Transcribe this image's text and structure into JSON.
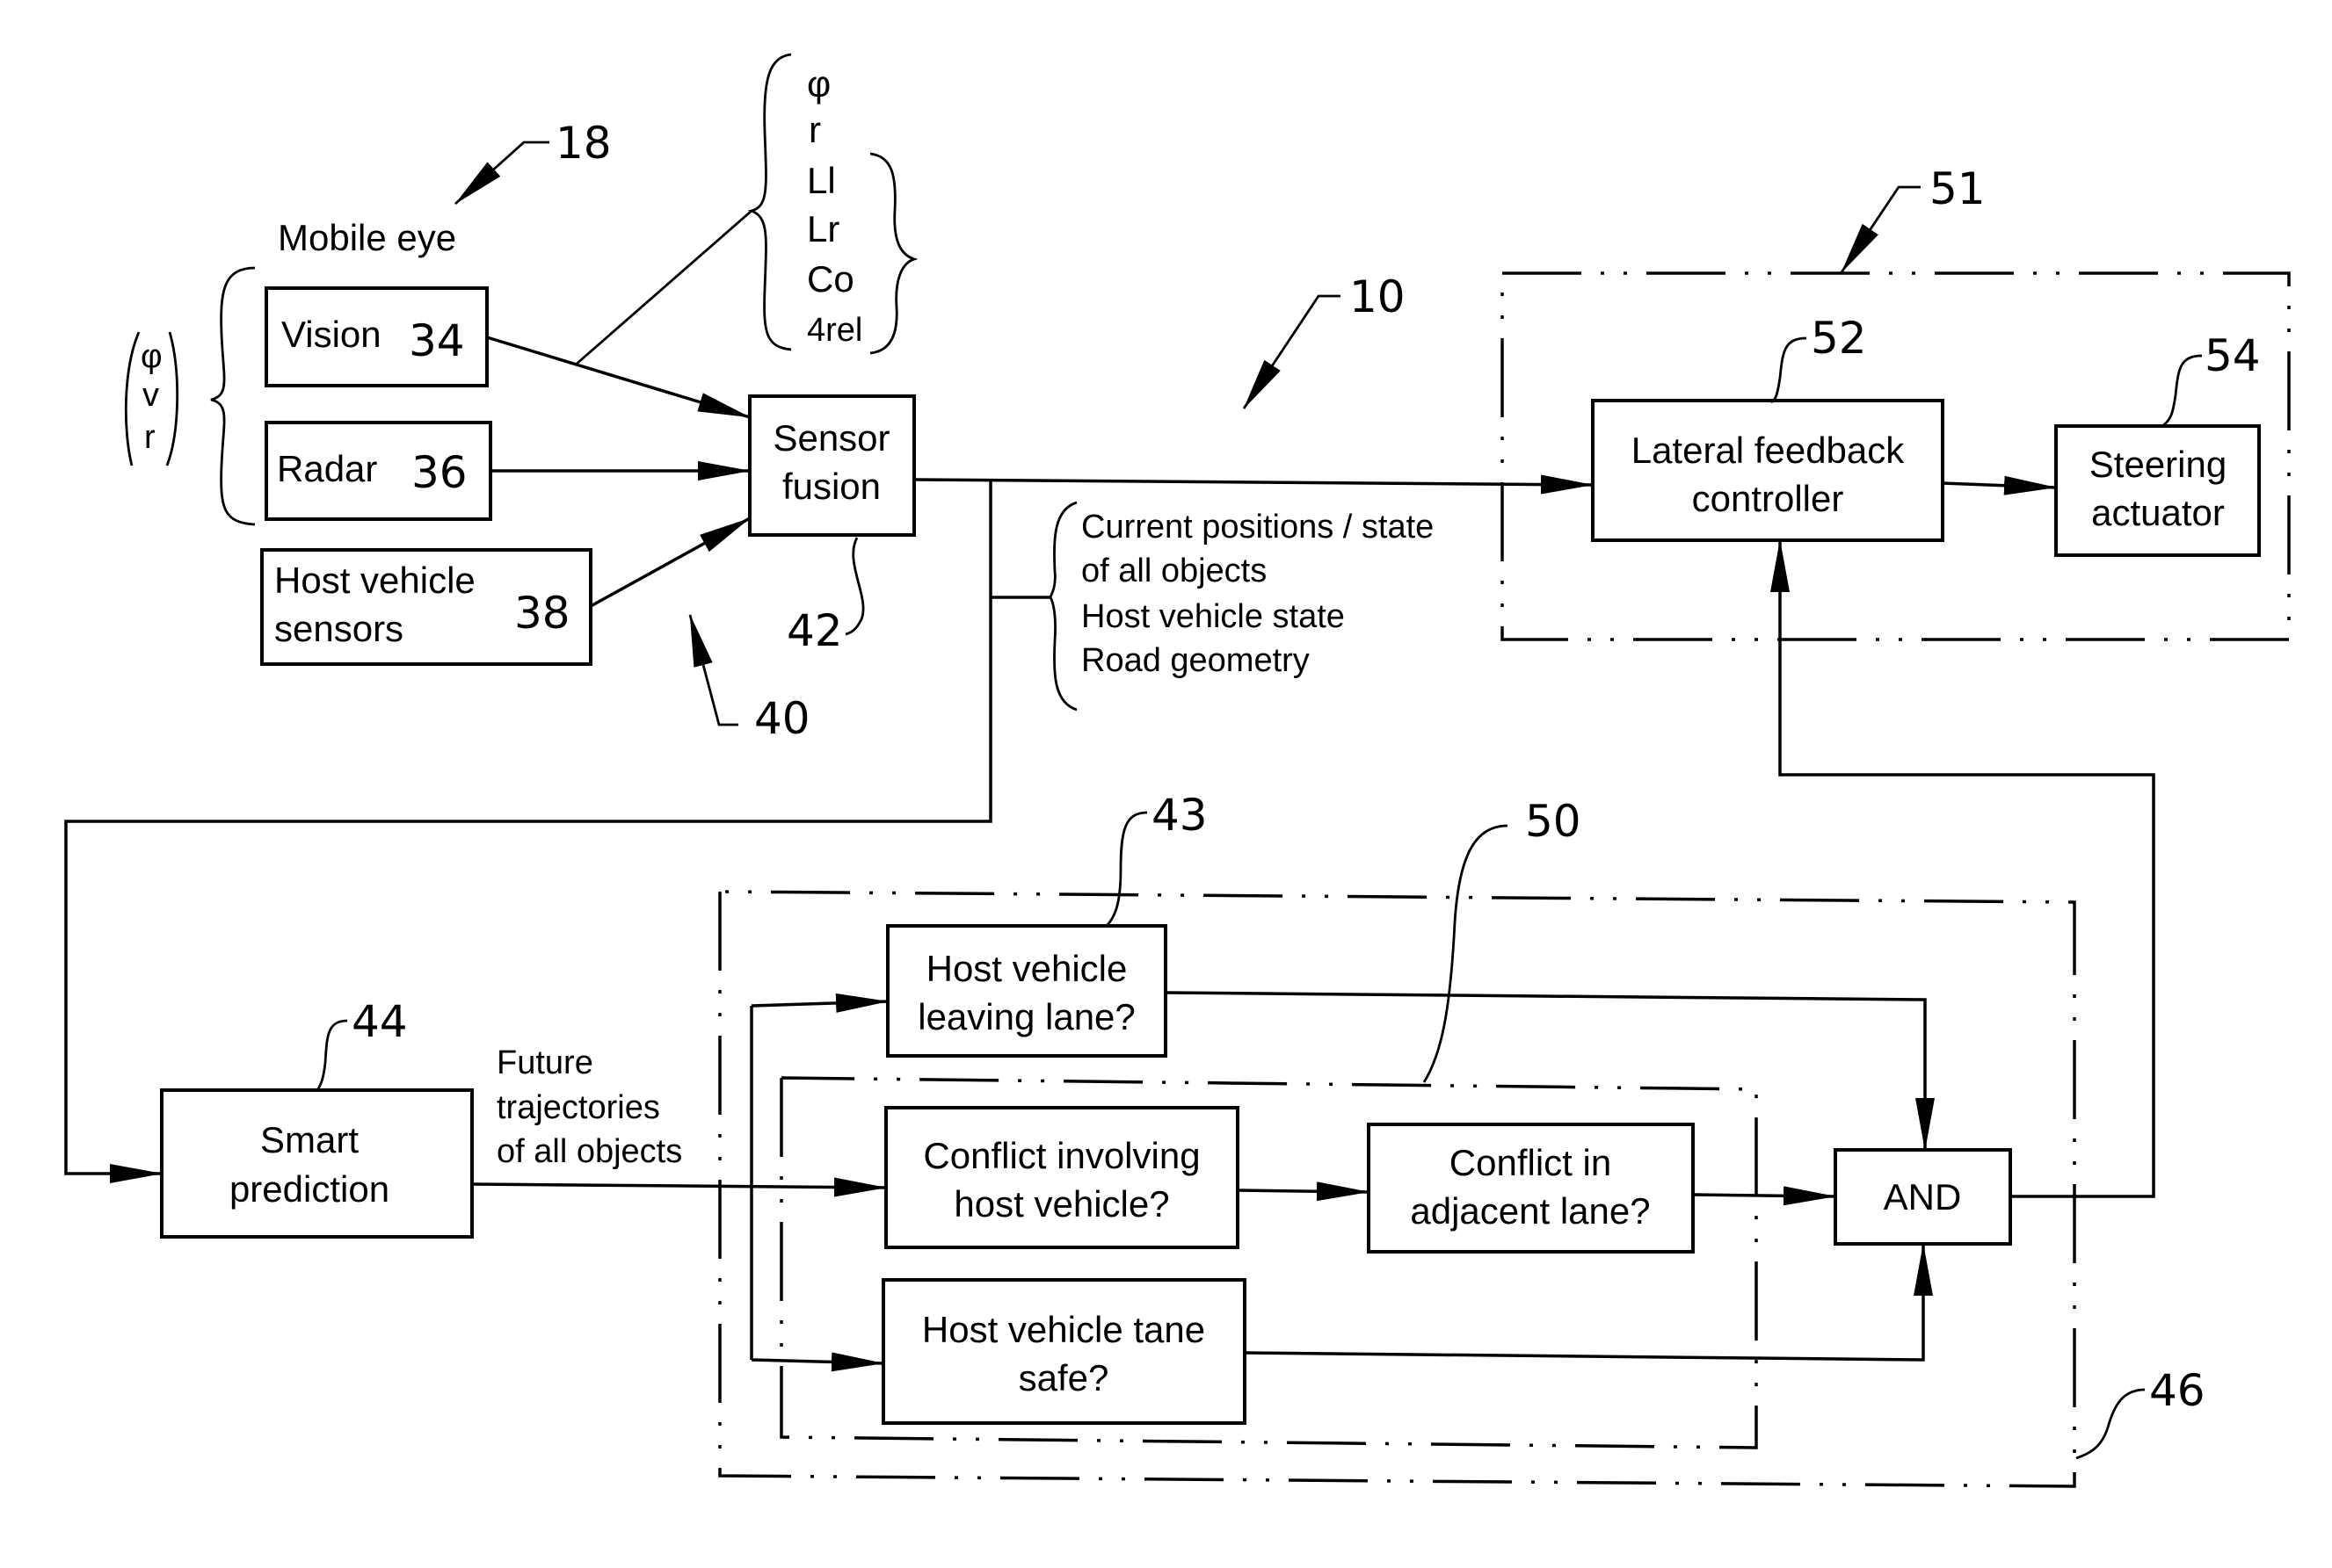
{
  "figure": {
    "system_ref": "10",
    "sensors_group": {
      "ref": "18",
      "title": "Mobile eye",
      "vision": {
        "label": "Vision",
        "ref": "34"
      },
      "radar": {
        "label": "Radar",
        "ref": "36"
      },
      "host_sensors": {
        "line1": "Host vehicle",
        "line2": "sensors",
        "ref": "38"
      },
      "outputs_left": [
        "φ",
        "v",
        "r"
      ],
      "outputs_vision": [
        "φ",
        "r",
        "Ll",
        "Lr",
        "Co",
        "4rel"
      ],
      "inputs_ref": "40"
    },
    "sensor_fusion": {
      "line1": "Sensor",
      "line2": "fusion",
      "ref": "42"
    },
    "fusion_outputs": [
      "Current positions / state",
      "of all objects",
      "Host vehicle state",
      "Road geometry"
    ],
    "control_group": {
      "ref": "51",
      "lateral_controller": {
        "line1": "Lateral feedback",
        "line2": "controller",
        "ref": "52"
      },
      "steering_actuator": {
        "line1": "Steering",
        "line2": "actuator",
        "ref": "54"
      }
    },
    "smart_prediction": {
      "line1": "Smart",
      "line2": "prediction",
      "ref": "44"
    },
    "prediction_output": [
      "Future",
      "trajectories",
      "of all objects"
    ],
    "decision_group": {
      "ref": "46",
      "inner_ref": "50",
      "leaving_lane": {
        "line1": "Host vehicle",
        "line2": "leaving lane?",
        "ref": "43"
      },
      "conflict_host": {
        "line1": "Conflict involving",
        "line2": "host vehicle?"
      },
      "conflict_adjacent": {
        "line1": "Conflict in",
        "line2": "adjacent lane?"
      },
      "lane_safe": {
        "line1": "Host vehicle tane",
        "line2": "safe?"
      },
      "and_gate": "AND"
    }
  }
}
